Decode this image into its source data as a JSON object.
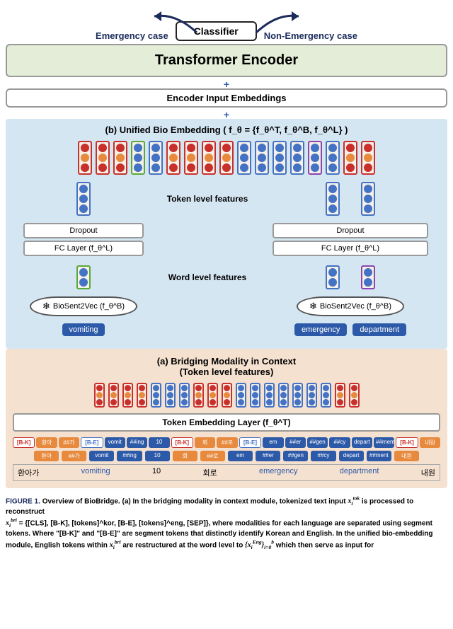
{
  "top": {
    "emergency": "Emergency case",
    "nonemergency": "Non-Emergency case",
    "classifier": "Classifier"
  },
  "transformer": "Transformer Encoder",
  "encoder_embed": "Encoder Input Embeddings",
  "plus": "+",
  "bio_section": {
    "title": "(b) Unified Bio Embedding  ( f_θ = {f_θ^T, f_θ^B, f_θ^L} )",
    "token_level": "Token level features",
    "word_level": "Word level features",
    "dropout": "Dropout",
    "fc": "FC Layer  (f_θ^L)",
    "biosent": "BioSent2Vec (f_θ^B)",
    "words": {
      "vomiting": "vomiting",
      "emergency": "emergency",
      "department": "department"
    }
  },
  "bridge_section": {
    "title1": "(a) Bridging Modality in Context",
    "title2": "(Token level features)",
    "token_embed": "Token Embedding Layer (f_θ^T)",
    "row1": [
      "[B-K]",
      "환아",
      "##가",
      "[B-E]",
      "vomit",
      "##ing",
      "10",
      "[B-K]",
      "회",
      "##로",
      "[B-E]",
      "em",
      "##er",
      "##gen",
      "##cy",
      "depart",
      "##ment",
      "[B-K]",
      "내원"
    ],
    "row1_cls": [
      "bk",
      "kor",
      "kor",
      "be",
      "eng",
      "eng",
      "eng",
      "bk",
      "kor",
      "kor",
      "be",
      "eng",
      "eng",
      "eng",
      "eng",
      "eng",
      "eng",
      "bk",
      "kor"
    ],
    "row2": [
      "환아",
      "##가",
      "vomit",
      "##ing",
      "10",
      "회",
      "##로",
      "em",
      "##er",
      "##gen",
      "##cy",
      "depart",
      "##ment",
      "내원"
    ],
    "row2_cls": [
      "kor",
      "kor",
      "eng",
      "eng",
      "eng",
      "kor",
      "kor",
      "eng",
      "eng",
      "eng",
      "eng",
      "eng",
      "eng",
      "kor"
    ],
    "src": [
      "환아가",
      "vomiting",
      "10",
      "회로",
      "emergency",
      "department",
      "내원"
    ],
    "src_cls": [
      "",
      "eng",
      "",
      "",
      "eng",
      "eng",
      ""
    ]
  },
  "caption": {
    "label": "FIGURE 1.",
    "line1": "Overview of BioBridge. (a) In the bridging modality in context module, tokenized text input ",
    "math1": "x_i^tok",
    "line2": " is processed to reconstruct",
    "line3_pre": "",
    "math2": "x_i^bri",
    "line3": " = {[CLS], [B-K], [tokens]^kor, [B-E], [tokens]^eng, [SEP]}, where modalities for each language are separated using segment tokens. Where \"[B-K]\" and \"[B-E]\" are segment tokens that distinctly identify Korean and English. In the unified bio-embedding module, English tokens within ",
    "math3": "x_i^bri",
    "line4": " are restructured at the word level to ",
    "math4": "{x_i^Eng}_{i=0}^b",
    "line5": " which then serve as input for"
  },
  "chart_data": {
    "type": "diagram",
    "title": "BioBridge Architecture Overview",
    "components": [
      {
        "name": "Classifier",
        "outputs": [
          "Emergency case",
          "Non-Emergency case"
        ]
      },
      {
        "name": "Transformer Encoder"
      },
      {
        "name": "Encoder Input Embeddings"
      },
      {
        "name": "Unified Bio Embedding",
        "sublayers": [
          "Token level features",
          "Dropout",
          "FC Layer (f_θ^L)",
          "Word level features",
          "BioSent2Vec (f_θ^B)"
        ],
        "example_words": [
          "vomiting",
          "emergency",
          "department"
        ]
      },
      {
        "name": "Bridging Modality in Context",
        "sublayers": [
          "Token level features",
          "Token Embedding Layer (f_θ^T)"
        ]
      }
    ],
    "token_sequence_with_segments": [
      "[B-K]",
      "환아",
      "##가",
      "[B-E]",
      "vomit",
      "##ing",
      "10",
      "[B-K]",
      "회",
      "##로",
      "[B-E]",
      "em",
      "##er",
      "##gen",
      "##cy",
      "depart",
      "##ment",
      "[B-K]",
      "내원"
    ],
    "token_sequence_plain": [
      "환아",
      "##가",
      "vomit",
      "##ing",
      "10",
      "회",
      "##로",
      "em",
      "##er",
      "##gen",
      "##cy",
      "depart",
      "##ment",
      "내원"
    ],
    "source_sentence": [
      "환아가",
      "vomiting",
      "10",
      "회로",
      "emergency",
      "department",
      "내원"
    ],
    "segment_tokens": {
      "korean": "[B-K]",
      "english": "[B-E]"
    },
    "functions": "f_θ = {f_θ^T, f_θ^B, f_θ^L}"
  }
}
